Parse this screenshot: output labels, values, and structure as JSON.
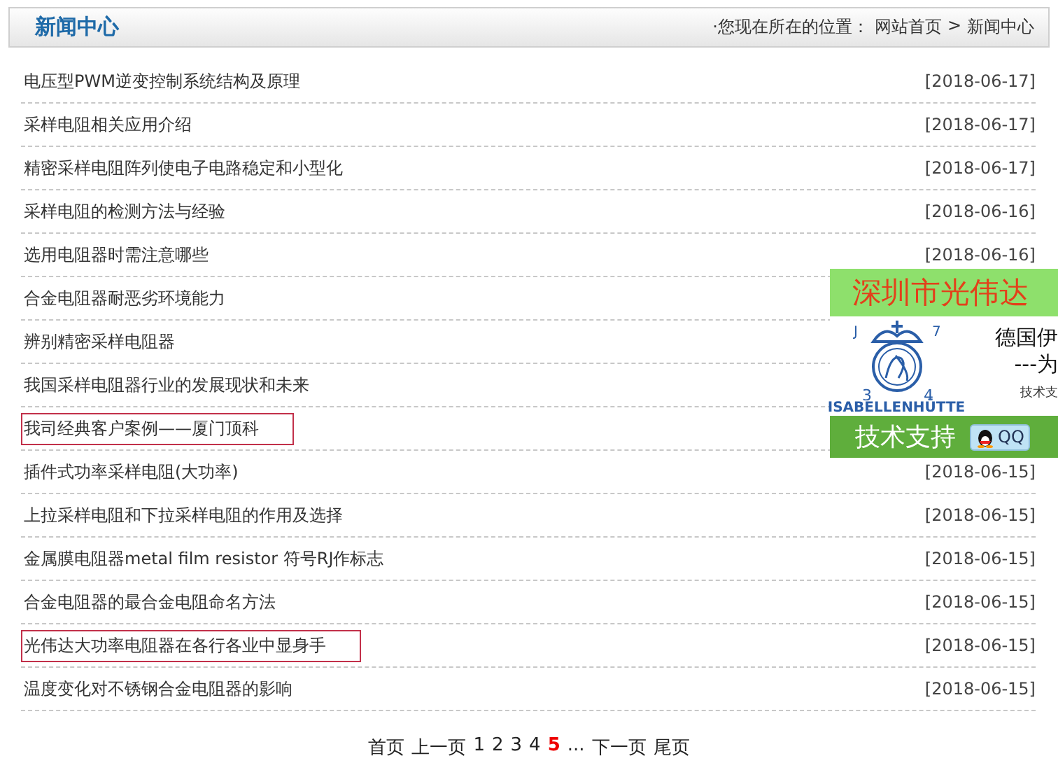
{
  "header": {
    "title": "新闻中心",
    "breadcrumb_label": "·您现在所在的位置：",
    "breadcrumb": [
      "网站首页",
      "新闻中心"
    ],
    "separator": ">"
  },
  "news": [
    {
      "title": "电压型PWM逆变控制系统结构及原理",
      "date": "[2018-06-17]",
      "boxed": false
    },
    {
      "title": "采样电阻相关应用介绍",
      "date": "[2018-06-17]",
      "boxed": false
    },
    {
      "title": "精密采样电阻阵列使电子电路稳定和小型化",
      "date": "[2018-06-17]",
      "boxed": false
    },
    {
      "title": "采样电阻的检测方法与经验",
      "date": "[2018-06-16]",
      "boxed": false
    },
    {
      "title": "选用电阻器时需注意哪些",
      "date": "[2018-06-16]",
      "boxed": false
    },
    {
      "title": "合金电阻器耐恶劣环境能力",
      "boxed": false
    },
    {
      "title": "辨别精密采样电阻器",
      "boxed": false
    },
    {
      "title": "我国采样电阻器行业的发展现状和未来",
      "boxed": false
    },
    {
      "title": "我司经典客户案例——厦门顶科",
      "boxed": true
    },
    {
      "title": "插件式功率采样电阻(大功率)",
      "date": "[2018-06-15]",
      "boxed": false
    },
    {
      "title": "上拉采样电阻和下拉采样电阻的作用及选择",
      "date": "[2018-06-15]",
      "boxed": false
    },
    {
      "title": "金属膜电阻器metal film resistor 符号RJ作标志",
      "date": "[2018-06-15]",
      "boxed": false
    },
    {
      "title": "合金电阻器的最合金电阻命名方法",
      "date": "[2018-06-15]",
      "boxed": false
    },
    {
      "title": "光伟达大功率电阻器在各行各业中显身手",
      "date": "[2018-06-15]",
      "boxed": true
    },
    {
      "title": "温度变化对不锈钢合金电阻器的影响",
      "date": "[2018-06-15]",
      "boxed": false
    }
  ],
  "pagination": {
    "first": "首页",
    "prev": "上一页",
    "pages": [
      {
        "label": "1",
        "selected": false
      },
      {
        "label": "2",
        "selected": false
      },
      {
        "label": "3",
        "selected": false
      },
      {
        "label": "4",
        "selected": false
      },
      {
        "label": "5",
        "selected": true
      }
    ],
    "ellipsis": "...",
    "next": "下一页",
    "last": "尾页"
  },
  "floating_ad": {
    "company": "深圳市光伟达",
    "logo_text": "ISABELLENHÜTTE",
    "logo_marks": [
      "J",
      "7",
      "3",
      "4"
    ],
    "line_1": "德国伊",
    "line_2": "---为",
    "line_3": "技术支",
    "support_button": "技术支持",
    "qq_button": "QQ"
  }
}
